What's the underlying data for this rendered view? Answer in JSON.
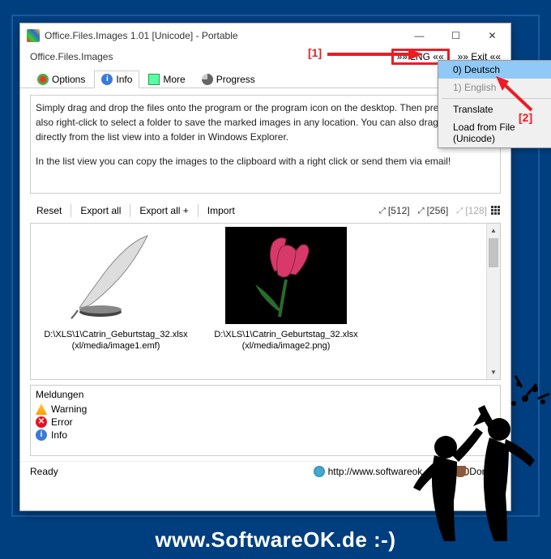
{
  "window": {
    "title": "Office.Files.Images 1.01 [Unicode] - Portable",
    "subtitle": "Office.Files.Images",
    "lng_label": "»» LNG ««",
    "exit_label": "»» Exit ««"
  },
  "tabs": {
    "options": "Options",
    "info": "Info",
    "more": "More",
    "progress": "Progress"
  },
  "info_text": {
    "p1": "Simply drag and drop the files onto the program or the program icon on the desktop. Then press \"... can also right-click to select a folder to save the marked images in any location. You can also drag them directly from the list view into a folder in Windows Explorer.",
    "p2": "In the list view you can copy the images to the clipboard with a right click or send them via email!"
  },
  "toolbar": {
    "reset": "Reset",
    "export_all": "Export all",
    "export_all_plus": "Export all +",
    "import": "Import",
    "zoom": {
      "z512": "[512]",
      "z256": "[256]",
      "z128": "[128]"
    }
  },
  "thumbs": [
    {
      "path": "D:\\XLS\\1\\Catrin_Geburtstag_32.xlsx",
      "sub": "(xl/media/image1.emf)"
    },
    {
      "path": "D:\\XLS\\1\\Catrin_Geburtstag_32.xlsx",
      "sub": "(xl/media/image2.png)"
    }
  ],
  "messages": {
    "title": "Meldungen",
    "warning": "Warning",
    "error": "Error",
    "info": "Info"
  },
  "status": {
    "ready": "Ready",
    "url": "http://www.softwareok.com",
    "donate": "Donate"
  },
  "dropdown": {
    "deutsch": "0) Deutsch",
    "english": "1) English",
    "translate": "Translate",
    "load": "Load from File (Unicode)"
  },
  "annotations": {
    "a1": "[1]",
    "a2": "[2]"
  },
  "caption": "www.SoftwareOK.de :-)"
}
